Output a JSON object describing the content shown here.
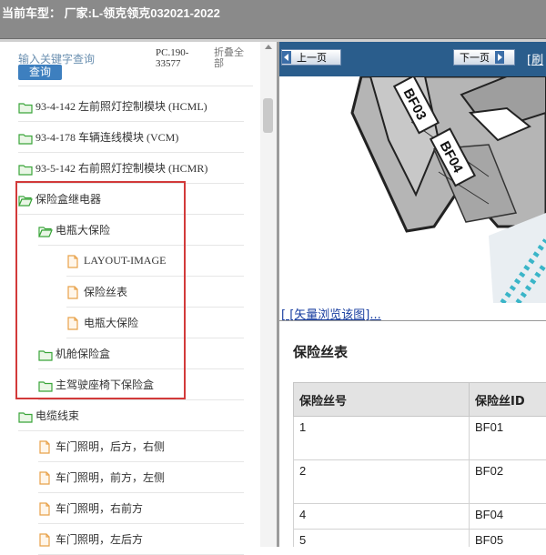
{
  "window": {
    "title": "当前车型：  厂家:L-领克领克032021-2022"
  },
  "sidebar": {
    "search_placeholder": "输入关键字查询",
    "search_button": "查询",
    "pc_info": "PC.190-33577",
    "collapse_all": "折叠全部",
    "items": [
      {
        "label": "93-4-142 左前照灯控制模块 (HCML)",
        "type": "folder",
        "level": 0
      },
      {
        "label": "93-4-178 车辆连线模块 (VCM)",
        "type": "folder",
        "level": 0
      },
      {
        "label": "93-5-142 右前照灯控制模块 (HCMR)",
        "type": "folder",
        "level": 0
      },
      {
        "label": "保险盒继电器",
        "type": "folder-open",
        "level": 0
      },
      {
        "label": "电瓶大保险",
        "type": "folder-open",
        "level": 1
      },
      {
        "label": "LAYOUT-IMAGE",
        "type": "doc",
        "level": 2
      },
      {
        "label": "保险丝表",
        "type": "doc",
        "level": 2
      },
      {
        "label": "电瓶大保险",
        "type": "doc",
        "level": 2
      },
      {
        "label": "机舱保险盒",
        "type": "folder",
        "level": 1
      },
      {
        "label": "主驾驶座椅下保险盒",
        "type": "folder",
        "level": 1
      },
      {
        "label": "电缆线束",
        "type": "folder",
        "level": 0
      },
      {
        "label": "车门照明，后方，右侧",
        "type": "doc",
        "level": 1
      },
      {
        "label": "车门照明，前方，左侧",
        "type": "doc",
        "level": 1
      },
      {
        "label": "车门照明，右前方",
        "type": "doc",
        "level": 1
      },
      {
        "label": "车门照明，左后方",
        "type": "doc",
        "level": 1
      }
    ]
  },
  "viewer": {
    "prev_label": "上一页",
    "next_label": "下一页",
    "refresh_label": "[刷",
    "diagram_labels": [
      "BF03",
      "BF04"
    ],
    "vector_link": "[ [矢量浏览该图]...",
    "table_title": "保险丝表",
    "table_headers": [
      "保险丝号",
      "保险丝ID"
    ],
    "table_rows": [
      [
        "1",
        "BF01"
      ],
      [
        "2",
        "BF02"
      ],
      [
        "4",
        "BF04"
      ],
      [
        "5",
        "BF05"
      ]
    ]
  },
  "colors": {
    "highlight_box": "#d23a3a",
    "nav_bar": "#2a5d8c",
    "folder_green": "#3aa53a",
    "doc_orange": "#e8a24a"
  }
}
